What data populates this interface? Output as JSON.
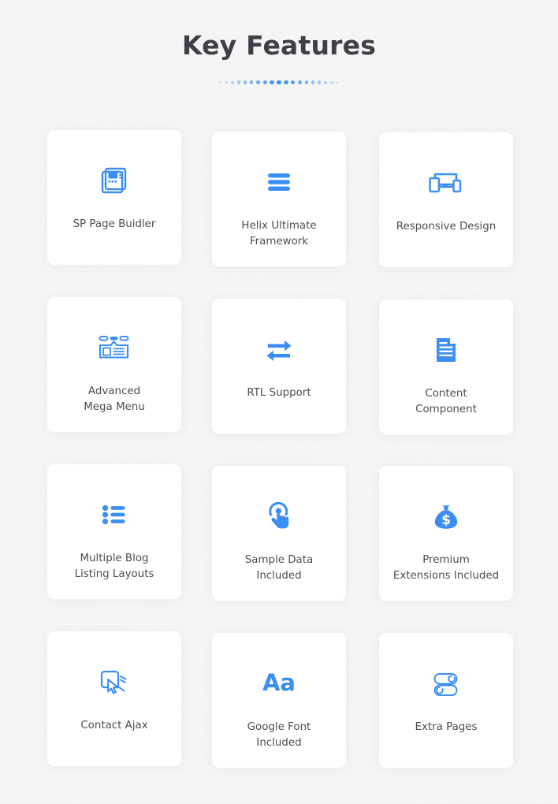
{
  "section": {
    "title": "Key Features",
    "separator": {
      "icon": "dotted-separator",
      "dot_count": 19,
      "color": "#3b8ef3"
    },
    "accent_color": "#3b8ef3",
    "text_color": "#4c4d53",
    "title_color": "#3f4047",
    "card_background": "#ffffff",
    "page_background": "#f7f7f7"
  },
  "features": [
    {
      "label": "SP Page Buidler",
      "icon": "pages-stack-icon"
    },
    {
      "label": "Helix Ultimate\nFramework",
      "icon": "hamburger-bars-icon"
    },
    {
      "label": "Responsive Design",
      "icon": "responsive-devices-icon"
    },
    {
      "label": "Advanced\nMega Menu",
      "icon": "mega-menu-icon"
    },
    {
      "label": "RTL Support",
      "icon": "exchange-arrows-icon"
    },
    {
      "label": "Content\nComponent",
      "icon": "document-icon"
    },
    {
      "label": "Multiple Blog\nListing Layouts",
      "icon": "bulleted-list-icon"
    },
    {
      "label": "Sample Data\nIncluded",
      "icon": "tap-hand-icon"
    },
    {
      "label": "Premium\nExtensions Included",
      "icon": "money-bag-icon"
    },
    {
      "label": "Contact Ajax",
      "icon": "click-cursor-icon"
    },
    {
      "label": "Google Font\nIncluded",
      "icon": "typography-aa-icon"
    },
    {
      "label": "Extra Pages",
      "icon": "toggle-switches-icon"
    }
  ]
}
